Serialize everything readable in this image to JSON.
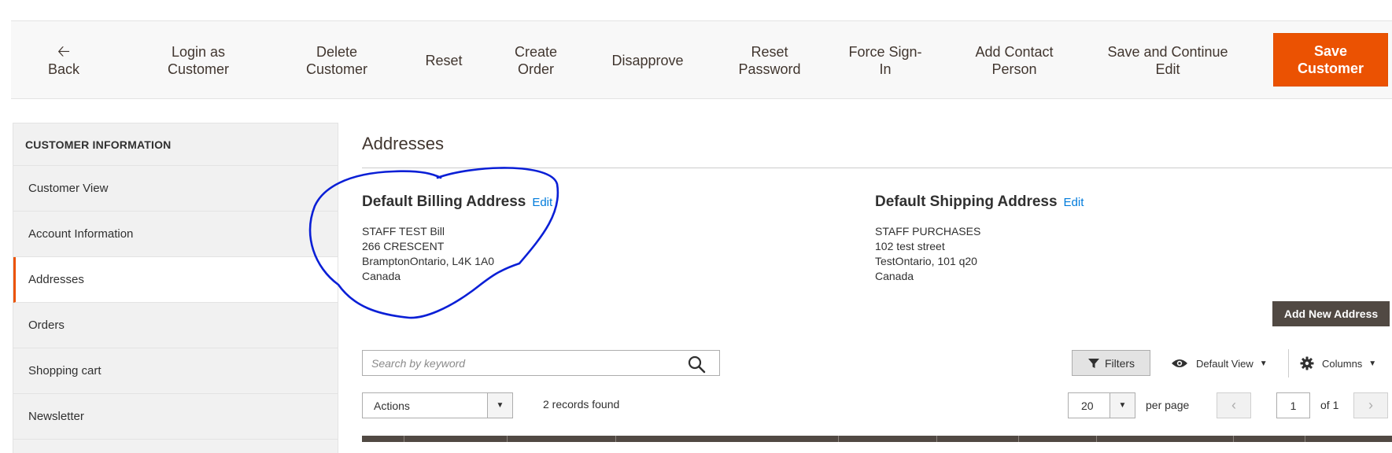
{
  "toolbar": {
    "back": "Back",
    "login_as_customer": [
      "Login as",
      "Customer"
    ],
    "delete_customer": [
      "Delete",
      "Customer"
    ],
    "reset": "Reset",
    "create_order": [
      "Create",
      "Order"
    ],
    "disapprove": "Disapprove",
    "reset_password": [
      "Reset",
      "Password"
    ],
    "force_sign_in": [
      "Force Sign-",
      "In"
    ],
    "add_contact_person": [
      "Add Contact",
      "Person"
    ],
    "save_and_continue": [
      "Save and Continue",
      "Edit"
    ],
    "save_customer": [
      "Save",
      "Customer"
    ]
  },
  "sidebar": {
    "title": "CUSTOMER INFORMATION",
    "items": [
      {
        "label": "Customer View"
      },
      {
        "label": "Account Information"
      },
      {
        "label": "Addresses",
        "active": true
      },
      {
        "label": "Orders"
      },
      {
        "label": "Shopping cart"
      },
      {
        "label": "Newsletter"
      }
    ]
  },
  "main": {
    "title": "Addresses",
    "billing": {
      "heading": "Default Billing Address",
      "edit": "Edit",
      "lines": [
        "STAFF TEST Bill",
        "266 CRESCENT",
        "BramptonOntario, L4K 1A0",
        "Canada"
      ]
    },
    "shipping": {
      "heading": "Default Shipping Address",
      "edit": "Edit",
      "lines": [
        "STAFF PURCHASES",
        "102 test street",
        "TestOntario, 101 q20",
        "Canada"
      ]
    },
    "add_new_address": "Add New Address"
  },
  "grid": {
    "search_placeholder": "Search by keyword",
    "filters": "Filters",
    "default_view": "Default View",
    "columns": "Columns",
    "actions": "Actions",
    "records_found": "2 records found",
    "per_page_value": "20",
    "per_page_label": "per page",
    "current_page": "1",
    "of_pages": "of 1"
  },
  "colors": {
    "accent": "#eb5202",
    "link": "#007bdb",
    "dark_button": "#514943",
    "annotation_ink": "#0a1fd6"
  }
}
